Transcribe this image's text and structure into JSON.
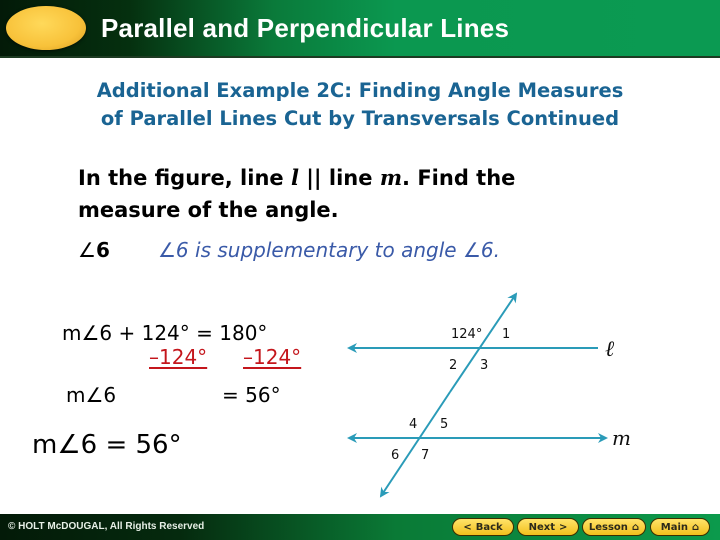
{
  "header": {
    "title": "Parallel and Perpendicular Lines",
    "colors": {
      "bar_dark": "#031a08",
      "bar_green": "#0b9a52",
      "oval": "#f8c23a"
    }
  },
  "heading": {
    "line1": "Additional Example 2C: Finding Angle Measures",
    "line2": "of Parallel Lines Cut by Transversals Continued",
    "color": "#1a6493"
  },
  "prompt": {
    "part1": "In the figure, line ",
    "line_l": "l",
    "parallel": " || line ",
    "line_m": "m",
    "part2": ". Find the",
    "line2": "measure of the angle."
  },
  "angle_row": {
    "angle_symbol": "∠",
    "angle_number": "6",
    "note": "∠6 is supplementary to angle ∠6."
  },
  "work": {
    "eq1": "m∠6 + 124° = 180°",
    "sub_left": "–124°",
    "sub_right": "–124°",
    "eq3_left": "m∠6",
    "eq3_right": "=  56°",
    "answer": "m∠6 = 56°",
    "subtract_color": "#c4161c"
  },
  "figure": {
    "line_color": "#2a9bb8",
    "given_angle_label": "124°",
    "angle_labels": [
      "1",
      "2",
      "3",
      "4",
      "5",
      "6",
      "7"
    ],
    "line_l_name": "ℓ",
    "line_m_name": "m"
  },
  "footer": {
    "copyright": "© HOLT McDOUGAL, All Rights Reserved",
    "buttons": [
      {
        "label": "Back",
        "icon": "chevron-left"
      },
      {
        "label": "Next",
        "icon": "chevron-right"
      },
      {
        "label": "Lesson",
        "icon": "home"
      },
      {
        "label": "Main",
        "icon": "home"
      }
    ]
  }
}
